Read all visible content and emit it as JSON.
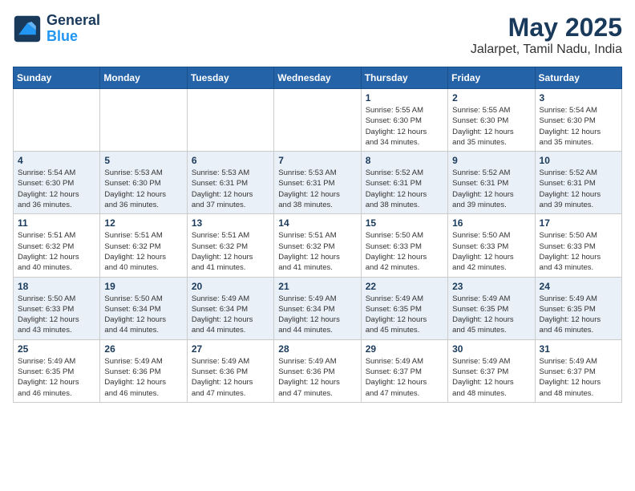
{
  "header": {
    "logo_line1": "General",
    "logo_line2": "Blue",
    "title": "May 2025",
    "subtitle": "Jalarpet, Tamil Nadu, India"
  },
  "days_of_week": [
    "Sunday",
    "Monday",
    "Tuesday",
    "Wednesday",
    "Thursday",
    "Friday",
    "Saturday"
  ],
  "weeks": [
    [
      {
        "day": "",
        "info": ""
      },
      {
        "day": "",
        "info": ""
      },
      {
        "day": "",
        "info": ""
      },
      {
        "day": "",
        "info": ""
      },
      {
        "day": "1",
        "info": "Sunrise: 5:55 AM\nSunset: 6:30 PM\nDaylight: 12 hours\nand 34 minutes."
      },
      {
        "day": "2",
        "info": "Sunrise: 5:55 AM\nSunset: 6:30 PM\nDaylight: 12 hours\nand 35 minutes."
      },
      {
        "day": "3",
        "info": "Sunrise: 5:54 AM\nSunset: 6:30 PM\nDaylight: 12 hours\nand 35 minutes."
      }
    ],
    [
      {
        "day": "4",
        "info": "Sunrise: 5:54 AM\nSunset: 6:30 PM\nDaylight: 12 hours\nand 36 minutes."
      },
      {
        "day": "5",
        "info": "Sunrise: 5:53 AM\nSunset: 6:30 PM\nDaylight: 12 hours\nand 36 minutes."
      },
      {
        "day": "6",
        "info": "Sunrise: 5:53 AM\nSunset: 6:31 PM\nDaylight: 12 hours\nand 37 minutes."
      },
      {
        "day": "7",
        "info": "Sunrise: 5:53 AM\nSunset: 6:31 PM\nDaylight: 12 hours\nand 38 minutes."
      },
      {
        "day": "8",
        "info": "Sunrise: 5:52 AM\nSunset: 6:31 PM\nDaylight: 12 hours\nand 38 minutes."
      },
      {
        "day": "9",
        "info": "Sunrise: 5:52 AM\nSunset: 6:31 PM\nDaylight: 12 hours\nand 39 minutes."
      },
      {
        "day": "10",
        "info": "Sunrise: 5:52 AM\nSunset: 6:31 PM\nDaylight: 12 hours\nand 39 minutes."
      }
    ],
    [
      {
        "day": "11",
        "info": "Sunrise: 5:51 AM\nSunset: 6:32 PM\nDaylight: 12 hours\nand 40 minutes."
      },
      {
        "day": "12",
        "info": "Sunrise: 5:51 AM\nSunset: 6:32 PM\nDaylight: 12 hours\nand 40 minutes."
      },
      {
        "day": "13",
        "info": "Sunrise: 5:51 AM\nSunset: 6:32 PM\nDaylight: 12 hours\nand 41 minutes."
      },
      {
        "day": "14",
        "info": "Sunrise: 5:51 AM\nSunset: 6:32 PM\nDaylight: 12 hours\nand 41 minutes."
      },
      {
        "day": "15",
        "info": "Sunrise: 5:50 AM\nSunset: 6:33 PM\nDaylight: 12 hours\nand 42 minutes."
      },
      {
        "day": "16",
        "info": "Sunrise: 5:50 AM\nSunset: 6:33 PM\nDaylight: 12 hours\nand 42 minutes."
      },
      {
        "day": "17",
        "info": "Sunrise: 5:50 AM\nSunset: 6:33 PM\nDaylight: 12 hours\nand 43 minutes."
      }
    ],
    [
      {
        "day": "18",
        "info": "Sunrise: 5:50 AM\nSunset: 6:33 PM\nDaylight: 12 hours\nand 43 minutes."
      },
      {
        "day": "19",
        "info": "Sunrise: 5:50 AM\nSunset: 6:34 PM\nDaylight: 12 hours\nand 44 minutes."
      },
      {
        "day": "20",
        "info": "Sunrise: 5:49 AM\nSunset: 6:34 PM\nDaylight: 12 hours\nand 44 minutes."
      },
      {
        "day": "21",
        "info": "Sunrise: 5:49 AM\nSunset: 6:34 PM\nDaylight: 12 hours\nand 44 minutes."
      },
      {
        "day": "22",
        "info": "Sunrise: 5:49 AM\nSunset: 6:35 PM\nDaylight: 12 hours\nand 45 minutes."
      },
      {
        "day": "23",
        "info": "Sunrise: 5:49 AM\nSunset: 6:35 PM\nDaylight: 12 hours\nand 45 minutes."
      },
      {
        "day": "24",
        "info": "Sunrise: 5:49 AM\nSunset: 6:35 PM\nDaylight: 12 hours\nand 46 minutes."
      }
    ],
    [
      {
        "day": "25",
        "info": "Sunrise: 5:49 AM\nSunset: 6:35 PM\nDaylight: 12 hours\nand 46 minutes."
      },
      {
        "day": "26",
        "info": "Sunrise: 5:49 AM\nSunset: 6:36 PM\nDaylight: 12 hours\nand 46 minutes."
      },
      {
        "day": "27",
        "info": "Sunrise: 5:49 AM\nSunset: 6:36 PM\nDaylight: 12 hours\nand 47 minutes."
      },
      {
        "day": "28",
        "info": "Sunrise: 5:49 AM\nSunset: 6:36 PM\nDaylight: 12 hours\nand 47 minutes."
      },
      {
        "day": "29",
        "info": "Sunrise: 5:49 AM\nSunset: 6:37 PM\nDaylight: 12 hours\nand 47 minutes."
      },
      {
        "day": "30",
        "info": "Sunrise: 5:49 AM\nSunset: 6:37 PM\nDaylight: 12 hours\nand 48 minutes."
      },
      {
        "day": "31",
        "info": "Sunrise: 5:49 AM\nSunset: 6:37 PM\nDaylight: 12 hours\nand 48 minutes."
      }
    ]
  ]
}
